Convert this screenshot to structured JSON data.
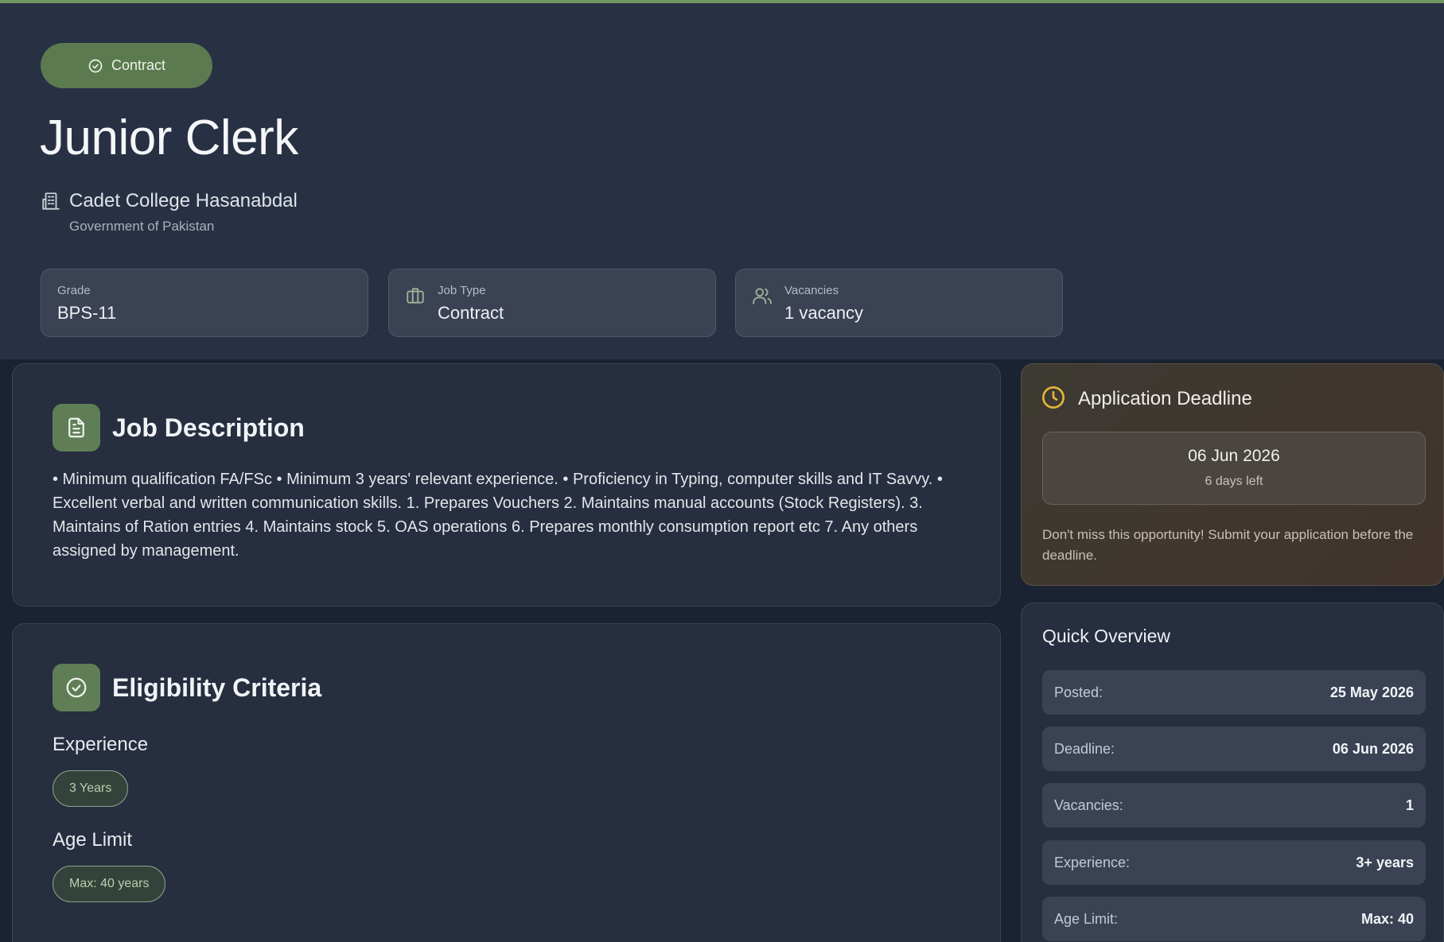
{
  "colors": {
    "accent_green": "#5f7e55",
    "deadline_bg": "#41342c",
    "clock_yellow": "#e4b53b"
  },
  "header": {
    "type_badge": "Contract",
    "title": "Junior Clerk",
    "organization": "Cadet College Hasanabdal",
    "organization_sub": "Government of Pakistan"
  },
  "stats": {
    "grade": {
      "label": "Grade",
      "value": "BPS-11"
    },
    "job_type": {
      "label": "Job Type",
      "value": "Contract",
      "icon": "briefcase-icon"
    },
    "vacancies": {
      "label": "Vacancies",
      "value": "1 vacancy",
      "icon": "users-icon"
    }
  },
  "job_description": {
    "title": "Job Description",
    "icon": "document-icon",
    "text": "• Minimum qualification FA/FSc • Minimum 3 years' relevant experience. • Proficiency in Typing, computer skills and IT Savvy. • Excellent verbal and written communication skills. 1. Prepares Vouchers 2. Maintains manual accounts (Stock Registers). 3. Maintains of Ration entries 4. Maintains stock 5. OAS operations 6. Prepares monthly consumption report etc 7. Any others assigned by management."
  },
  "eligibility": {
    "title": "Eligibility Criteria",
    "icon": "check-circle-icon",
    "experience_label": "Experience",
    "experience_value": "3 Years",
    "age_label": "Age Limit",
    "age_value": "Max: 40 years"
  },
  "deadline": {
    "title": "Application Deadline",
    "icon": "clock-icon",
    "date": "06 Jun 2026",
    "days_left": "6 days left",
    "message": "Don't miss this opportunity! Submit your application before the deadline."
  },
  "overview": {
    "title": "Quick Overview",
    "rows": [
      {
        "key": "Posted:",
        "value": "25 May 2026"
      },
      {
        "key": "Deadline:",
        "value": "06 Jun 2026"
      },
      {
        "key": "Vacancies:",
        "value": "1"
      },
      {
        "key": "Experience:",
        "value": "3+ years"
      },
      {
        "key": "Age Limit:",
        "value": "Max: 40"
      }
    ]
  }
}
